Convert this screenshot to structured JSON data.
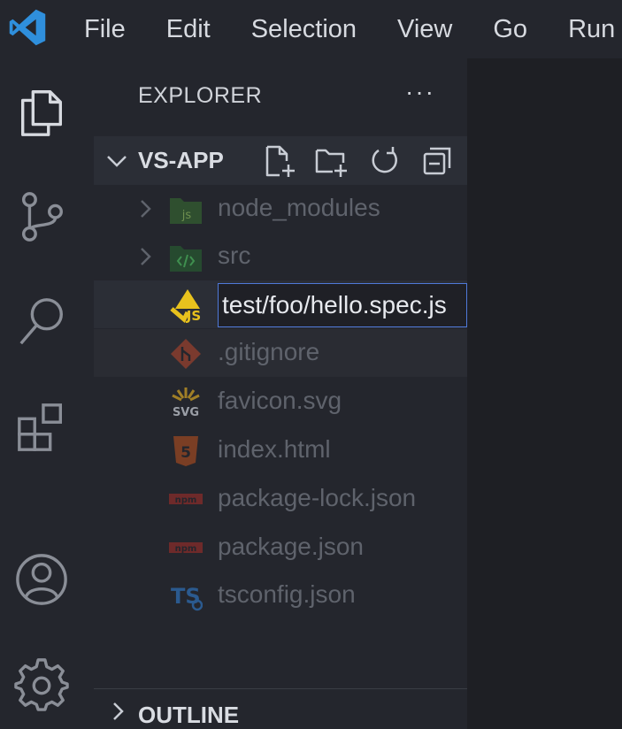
{
  "menu": [
    "File",
    "Edit",
    "Selection",
    "View",
    "Go",
    "Run"
  ],
  "activity": [
    {
      "name": "explorer-icon"
    },
    {
      "name": "source-control-icon"
    },
    {
      "name": "search-icon"
    },
    {
      "name": "extensions-icon"
    },
    {
      "name": "account-icon"
    },
    {
      "name": "settings-gear-icon"
    }
  ],
  "explorer": {
    "header": "EXPLORER",
    "more": "···",
    "project": "VS-APP",
    "files": [
      {
        "label": "node_modules",
        "icon": "folder-js-icon",
        "folder": true
      },
      {
        "label": "src",
        "icon": "folder-src-icon",
        "folder": true
      },
      {
        "label": "",
        "icon": "js-test-icon",
        "folder": false,
        "editing": true
      },
      {
        "label": ".gitignore",
        "icon": "git-icon",
        "folder": false
      },
      {
        "label": "favicon.svg",
        "icon": "svg-icon",
        "folder": false
      },
      {
        "label": "index.html",
        "icon": "html5-icon",
        "folder": false
      },
      {
        "label": "package-lock.json",
        "icon": "npm-icon",
        "folder": false
      },
      {
        "label": "package.json",
        "icon": "npm-icon",
        "folder": false
      },
      {
        "label": "tsconfig.json",
        "icon": "typescript-icon",
        "folder": false
      }
    ],
    "rename_value": "test/foo/hello.spec.js",
    "outline": "OUTLINE"
  },
  "colors": {
    "accent": "#4f79d9",
    "vscode_blue": "#2f8fdc",
    "js_yellow": "#e8c21d"
  }
}
